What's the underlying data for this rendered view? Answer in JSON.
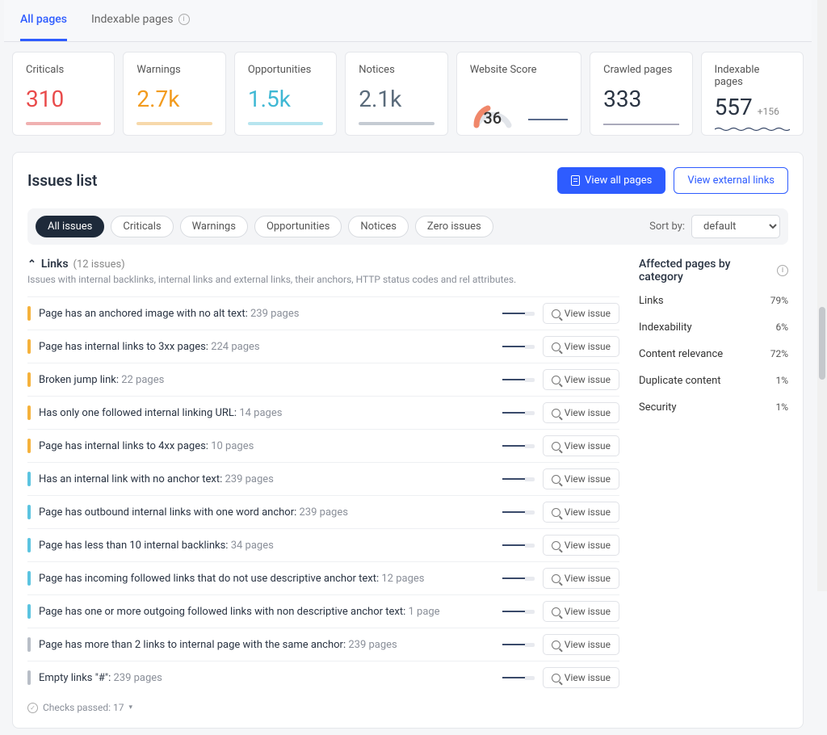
{
  "tabs": {
    "all": "All pages",
    "indexable": "Indexable pages"
  },
  "cards": [
    {
      "title": "Criticals",
      "value": "310",
      "color": "c-red",
      "spark": "s-red"
    },
    {
      "title": "Warnings",
      "value": "2.7k",
      "color": "c-orange",
      "spark": "s-orange"
    },
    {
      "title": "Opportunities",
      "value": "1.5k",
      "color": "c-teal",
      "spark": "s-teal"
    },
    {
      "title": "Notices",
      "value": "2.1k",
      "color": "c-gray",
      "spark": "s-gray"
    }
  ],
  "score_card": {
    "title": "Website Score",
    "value": "36"
  },
  "crawled_card": {
    "title": "Crawled pages",
    "value": "333"
  },
  "indexable_card": {
    "title": "Indexable pages",
    "value": "557",
    "delta": "+156"
  },
  "issues": {
    "title": "Issues list",
    "view_all": "View all pages",
    "view_ext": "View external links",
    "filters": [
      "All issues",
      "Criticals",
      "Warnings",
      "Opportunities",
      "Notices",
      "Zero issues"
    ],
    "sort_label": "Sort by:",
    "sort_value": "default",
    "section": {
      "name": "Links",
      "count": "(12 issues)",
      "desc": "Issues with internal backlinks, internal links and external links, their anchors, HTTP status codes and rel attributes."
    },
    "rows": [
      {
        "sev": "sev-warn",
        "text": "Page has an anchored image with no alt text:",
        "pages": "239 pages"
      },
      {
        "sev": "sev-warn",
        "text": "Page has internal links to 3xx pages:",
        "pages": "224 pages"
      },
      {
        "sev": "sev-warn",
        "text": "Broken jump link:",
        "pages": "22 pages"
      },
      {
        "sev": "sev-warn",
        "text": "Has only one followed internal linking URL:",
        "pages": "14 pages"
      },
      {
        "sev": "sev-warn",
        "text": "Page has internal links to 4xx pages:",
        "pages": "10 pages"
      },
      {
        "sev": "sev-opp",
        "text": "Has an internal link with no anchor text:",
        "pages": "239 pages"
      },
      {
        "sev": "sev-opp",
        "text": "Page has outbound internal links with one word anchor:",
        "pages": "239 pages"
      },
      {
        "sev": "sev-opp",
        "text": "Page has less than 10 internal backlinks:",
        "pages": "34 pages"
      },
      {
        "sev": "sev-opp",
        "text": "Page has incoming followed links that do not use descriptive anchor text:",
        "pages": "12 pages"
      },
      {
        "sev": "sev-opp",
        "text": "Page has one or more outgoing followed links with non descriptive anchor text:",
        "pages": "1 page"
      },
      {
        "sev": "sev-notice",
        "text": "Page has more than 2 links to internal page with the same anchor:",
        "pages": "239 pages"
      },
      {
        "sev": "sev-notice",
        "text": "Empty links \"#\":",
        "pages": "239 pages"
      }
    ],
    "view_issue": "View issue",
    "passed": "Checks passed: 17"
  },
  "categories": {
    "title": "Affected pages by category",
    "items": [
      {
        "name": "Links",
        "pct": "79%",
        "red": 79
      },
      {
        "name": "Indexability",
        "pct": "6%",
        "red": 6
      },
      {
        "name": "Content relevance",
        "pct": "72%",
        "red": 72
      },
      {
        "name": "Duplicate content",
        "pct": "1%",
        "red": 1
      },
      {
        "name": "Security",
        "pct": "1%",
        "red": 1
      }
    ]
  }
}
